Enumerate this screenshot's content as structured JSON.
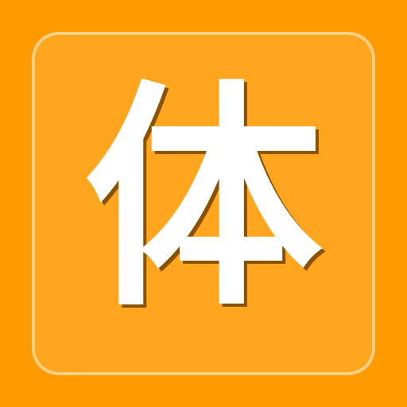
{
  "icon": {
    "glyph": "体",
    "colors": {
      "background": "#ff9a00",
      "tile": "#ffa51e",
      "tile_border": "#ffd696",
      "glyph": "#ffffff",
      "glyph_shadow": "#8a5200"
    }
  }
}
